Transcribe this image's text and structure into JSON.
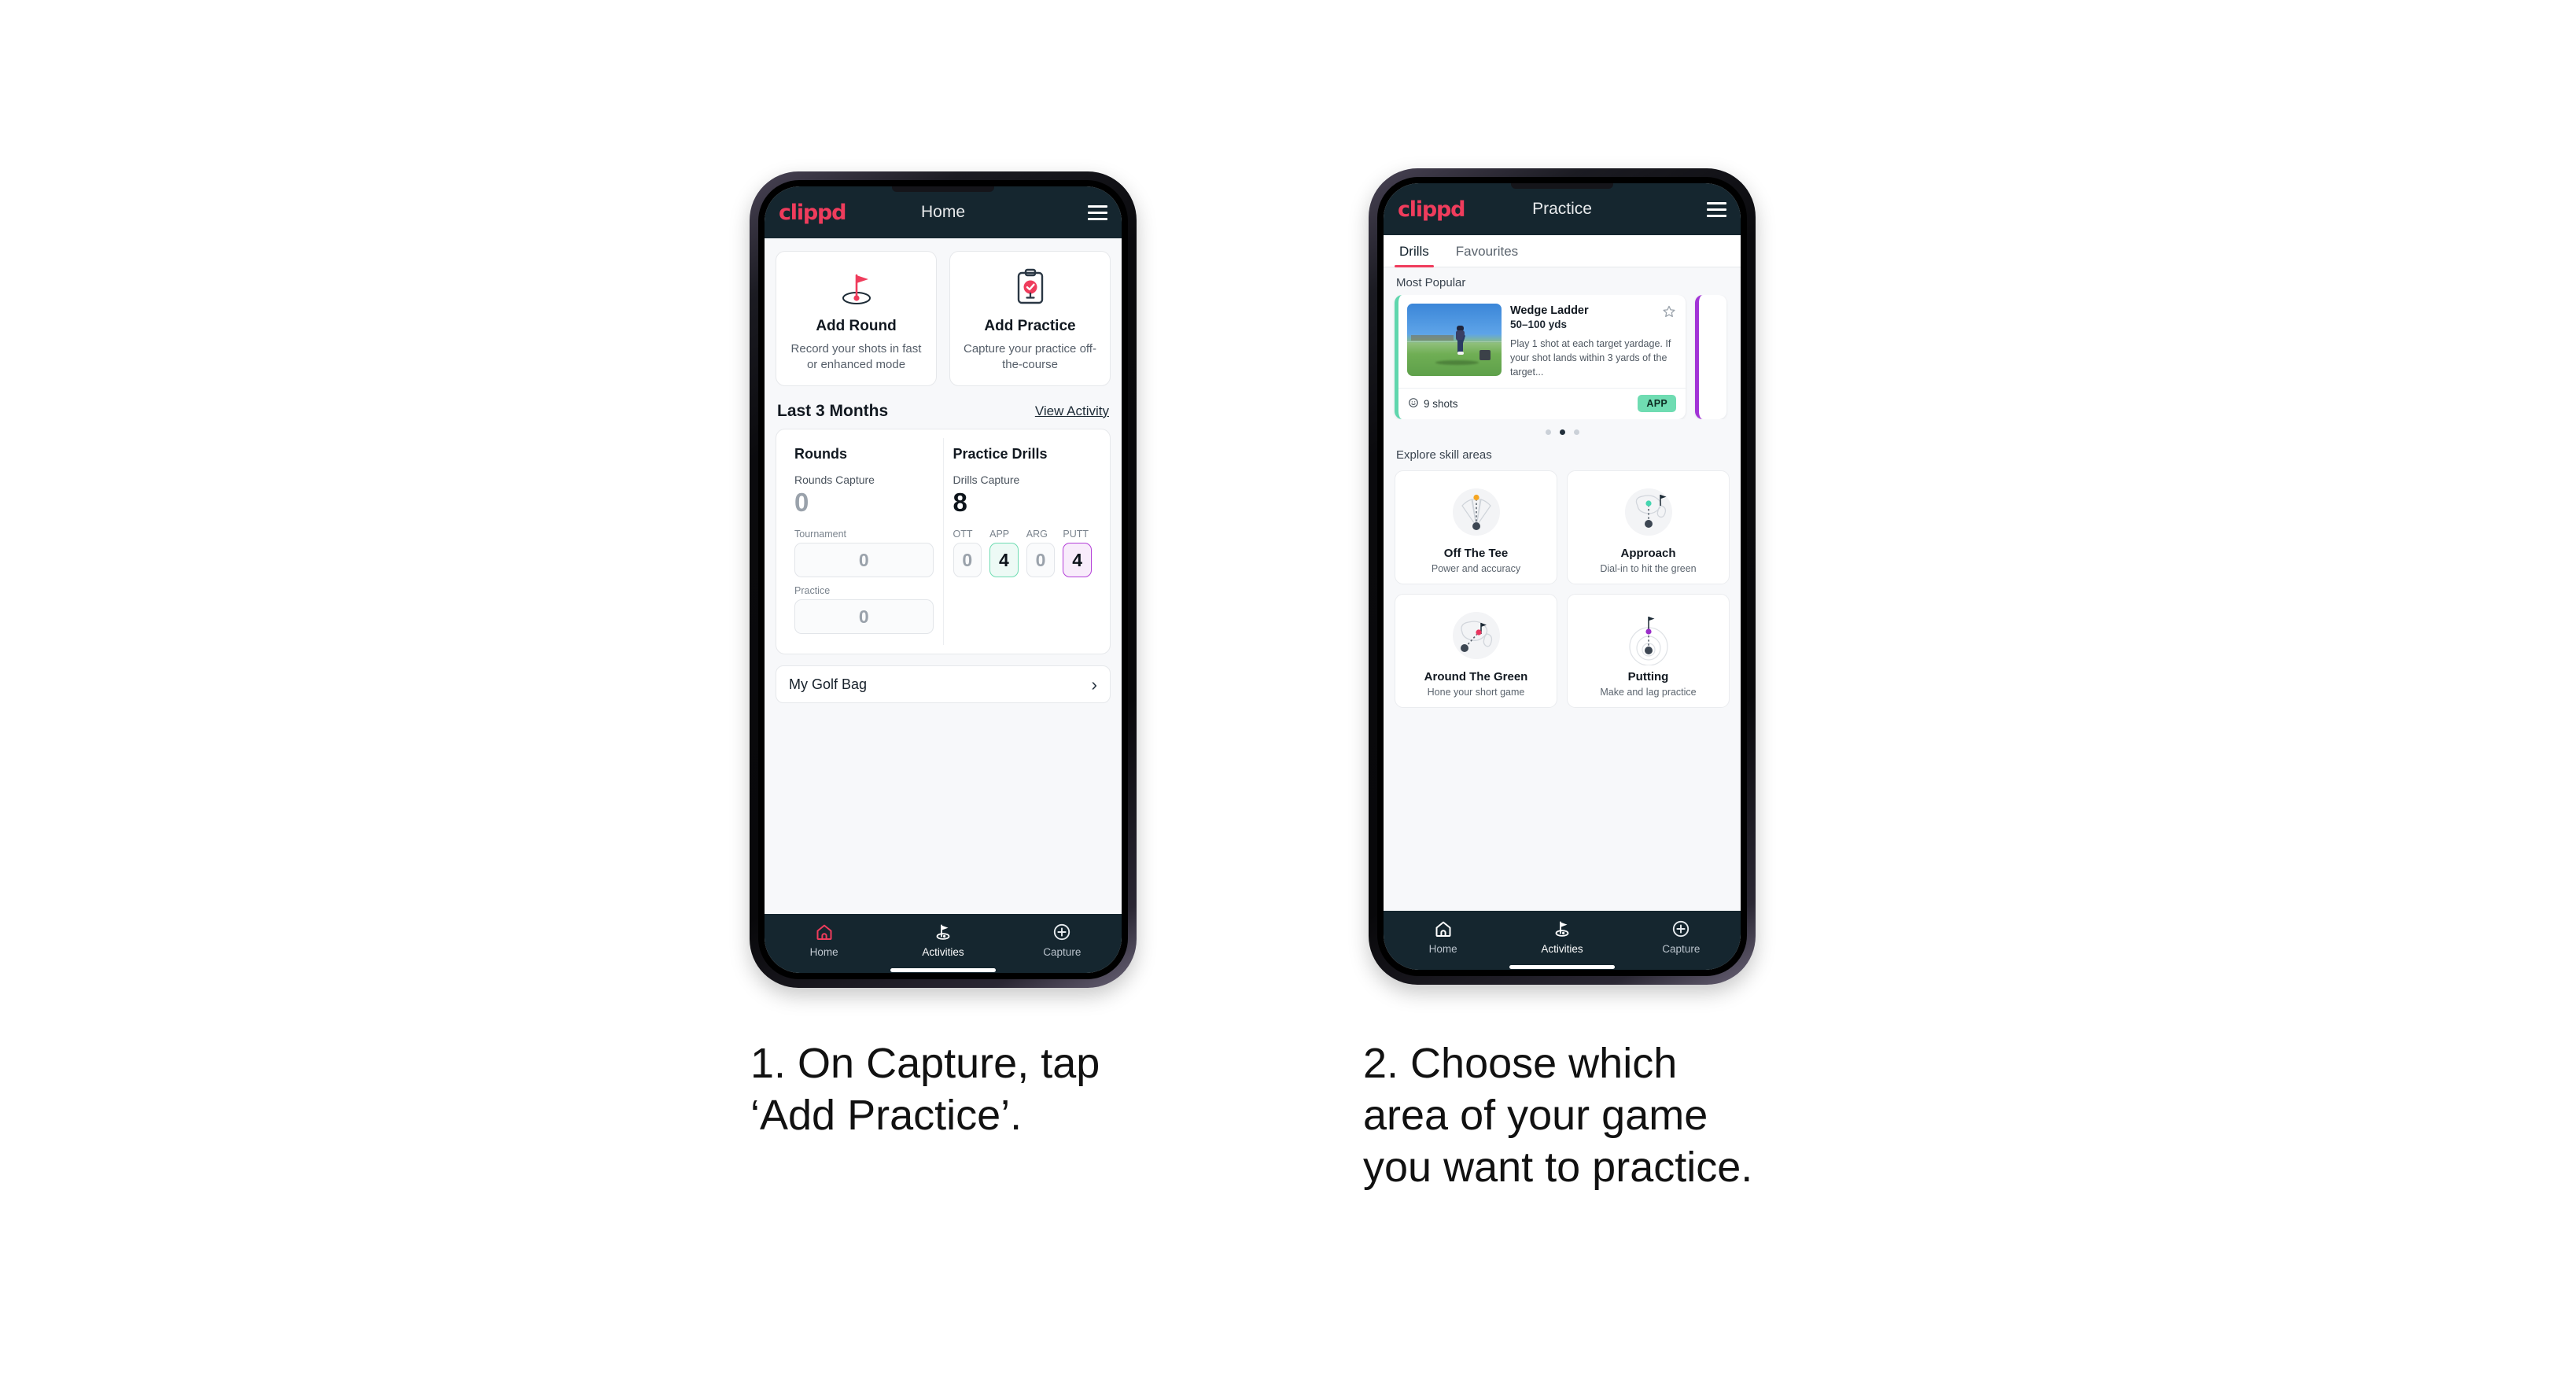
{
  "page": {
    "background": "#ffffff",
    "brand_color": "#ef3c5c",
    "appbar_color": "#15262f"
  },
  "phone1": {
    "appbar": {
      "brand": "clippd",
      "title": "Home",
      "menu_icon": "hamburger-icon"
    },
    "actions": [
      {
        "icon": "golf-flag-hole-icon",
        "title": "Add Round",
        "subtitle": "Record your shots in fast or enhanced mode"
      },
      {
        "icon": "clipboard-check-icon",
        "title": "Add Practice",
        "subtitle": "Capture your practice off-the-course"
      }
    ],
    "section": {
      "title": "Last 3 Months",
      "link": "View Activity"
    },
    "stats": {
      "rounds": {
        "heading": "Rounds",
        "capture_label": "Rounds Capture",
        "capture_value": "0",
        "boxes": [
          {
            "caption": "Tournament",
            "value": "0",
            "style": "plain"
          },
          {
            "caption": "Practice",
            "value": "0",
            "style": "plain"
          }
        ]
      },
      "drills": {
        "heading": "Practice Drills",
        "capture_label": "Drills Capture",
        "capture_value": "8",
        "boxes": [
          {
            "caption": "OTT",
            "value": "0",
            "style": "plain"
          },
          {
            "caption": "APP",
            "value": "4",
            "style": "green"
          },
          {
            "caption": "ARG",
            "value": "0",
            "style": "plain"
          },
          {
            "caption": "PUTT",
            "value": "4",
            "style": "purple"
          }
        ]
      }
    },
    "golf_bag": {
      "label": "My Golf Bag",
      "chevron": "chevron-right-icon"
    },
    "nav": [
      {
        "icon": "home-icon",
        "label": "Home",
        "state": "active"
      },
      {
        "icon": "golf-flag-icon",
        "label": "Activities",
        "state": "white"
      },
      {
        "icon": "plus-circle-icon",
        "label": "Capture",
        "state": "default"
      }
    ]
  },
  "phone2": {
    "appbar": {
      "brand": "clippd",
      "title": "Practice",
      "menu_icon": "hamburger-icon"
    },
    "tabs": [
      {
        "label": "Drills",
        "active": true
      },
      {
        "label": "Favourites",
        "active": false
      }
    ],
    "most_popular_label": "Most Popular",
    "drill": {
      "title": "Wedge Ladder",
      "yardage": "50–100 yds",
      "description": "Play 1 shot at each target yardage. If your shot lands within 3 yards of the target...",
      "shots": "9 shots",
      "badge": "APP",
      "badge_color": "#6fdcb2",
      "accent_color": "#5fd6ad",
      "favourite_icon": "star-outline-icon",
      "shots_icon": "clock-icon"
    },
    "carousel_dots": {
      "count": 3,
      "active_index": 1
    },
    "explore_label": "Explore skill areas",
    "skills": [
      {
        "icon": "off-the-tee-icon",
        "title": "Off The Tee",
        "subtitle": "Power and accuracy",
        "dot_color": "#f5a623"
      },
      {
        "icon": "approach-icon",
        "title": "Approach",
        "subtitle": "Dial-in to hit the green",
        "dot_color": "#45d6b0"
      },
      {
        "icon": "around-the-green-icon",
        "title": "Around The Green",
        "subtitle": "Hone your short game",
        "dot_color": "#e8365f"
      },
      {
        "icon": "putting-icon",
        "title": "Putting",
        "subtitle": "Make and lag practice",
        "dot_color": "#9b2fc9"
      }
    ],
    "nav": [
      {
        "icon": "home-icon",
        "label": "Home",
        "state": "default"
      },
      {
        "icon": "golf-flag-icon",
        "label": "Activities",
        "state": "white"
      },
      {
        "icon": "plus-circle-icon",
        "label": "Capture",
        "state": "default"
      }
    ]
  },
  "captions": {
    "step1": "1. On Capture, tap\n‘Add Practice’.",
    "step2": "2. Choose which\narea of your game\nyou want to practice."
  }
}
